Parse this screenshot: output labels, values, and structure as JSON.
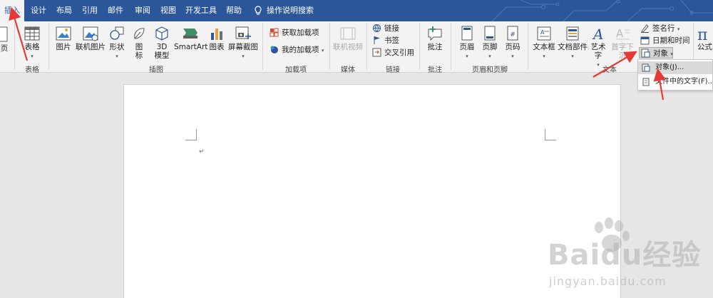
{
  "tabs": [
    {
      "label": "插入",
      "active": true
    },
    {
      "label": "设计"
    },
    {
      "label": "布局"
    },
    {
      "label": "引用"
    },
    {
      "label": "邮件"
    },
    {
      "label": "审阅"
    },
    {
      "label": "视图"
    },
    {
      "label": "开发工具"
    },
    {
      "label": "帮助"
    }
  ],
  "search": {
    "label": "操作说明搜索",
    "icon": "lightbulb-icon"
  },
  "ribbon": {
    "page_label": "页",
    "table": {
      "label": "表格",
      "group": "表格"
    },
    "illustrations": {
      "group": "插图",
      "picture": "图片",
      "online_picture": "联机图片",
      "shapes": "形状",
      "icons_line1": "图",
      "icons_line2": "标",
      "model_line1": "3D",
      "model_line2": "模型",
      "smartart": "SmartArt",
      "chart": "图表",
      "screenshot": "屏幕截图"
    },
    "addins": {
      "group": "加载项",
      "get": "获取加载项",
      "my": "我的加载项"
    },
    "media": {
      "group": "媒体",
      "online_video": "联机视频"
    },
    "links": {
      "group": "链接",
      "link": "链接",
      "bookmark": "书签",
      "cross_ref": "交叉引用"
    },
    "comments": {
      "group": "批注",
      "comment": "批注"
    },
    "header_footer": {
      "group": "页眉和页脚",
      "header": "页眉",
      "footer": "页脚",
      "page_number": "页码"
    },
    "text": {
      "group": "文本",
      "textbox": "文本框",
      "quick_parts": "文档部件",
      "wordart": "艺术字",
      "drop_cap": "首字下沉",
      "signature": "签名行",
      "datetime": "日期和时间",
      "object": "对象"
    },
    "symbols": {
      "equation": "公式"
    }
  },
  "dropdown": {
    "item1": "对象(J)...",
    "item2": "文件中的文字(F)..."
  },
  "document": {
    "paragraph_mark": "↵"
  },
  "watermark": {
    "brand": "Baidu经验",
    "url": "jingyan.baidu.com"
  },
  "colors": {
    "accent": "#2b579a",
    "arrow": "#e53935"
  }
}
